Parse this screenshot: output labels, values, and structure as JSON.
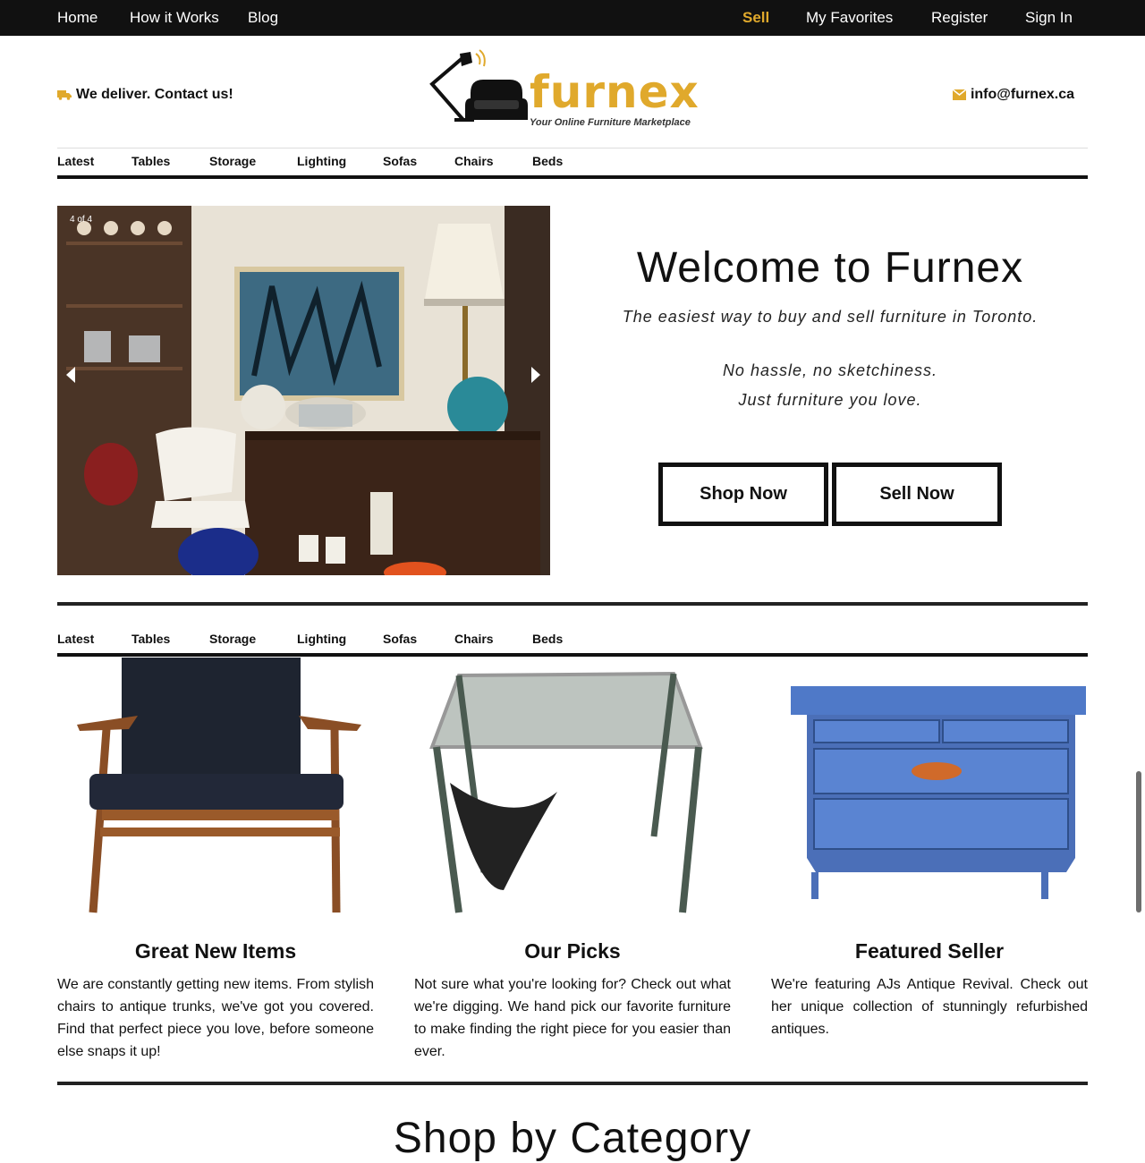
{
  "topnav": {
    "left": [
      "Home",
      "How it Works",
      "Blog"
    ],
    "right": {
      "sell": "Sell",
      "favorites": "My Favorites",
      "register": "Register",
      "signin": "Sign In"
    }
  },
  "header": {
    "deliver": "We deliver. Contact us!",
    "email": "info@furnex.ca",
    "logo_word": "furnex",
    "logo_tagline": "Your Online Furniture Marketplace"
  },
  "categories": [
    "Latest",
    "Tables",
    "Storage",
    "Lighting",
    "Sofas",
    "Chairs",
    "Beds"
  ],
  "hero": {
    "slide_counter": "4 of 4",
    "title": "Welcome to Furnex",
    "tagline": "The easiest way to buy and sell furniture in Toronto.",
    "line2": "No hassle, no sketchiness.",
    "line3": "Just furniture you love.",
    "shop_button": "Shop Now",
    "sell_button": "Sell Now"
  },
  "cards": [
    {
      "title": "Great New Items",
      "text": "We are constantly getting new items. From stylish chairs to antique trunks, we've got you covered. Find that perfect piece you love, before someone else snaps it up!"
    },
    {
      "title": "Our Picks",
      "text": "Not sure what you're looking for? Check out what we're digging. We hand pick our favorite furniture to make finding the right piece for you easier than ever."
    },
    {
      "title": "Featured Seller",
      "text": "We're featuring AJs Antique Revival. Check out her unique collection of stunningly refurbished antiques."
    }
  ],
  "section_title": "Shop by Category",
  "colors": {
    "accent": "#e0a92c",
    "nav_bg": "#111111",
    "text": "#111111"
  },
  "icons": {
    "deliver": "truck-icon",
    "email": "envelope-icon"
  }
}
